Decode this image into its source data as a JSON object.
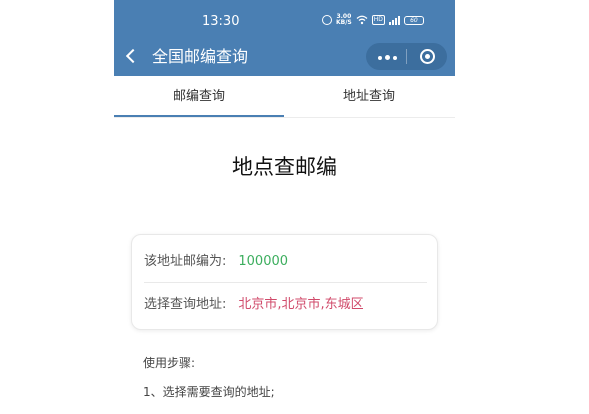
{
  "status_bar": {
    "time": "13:30",
    "speed": "3.00 KB/S",
    "speed_value": "3.00",
    "speed_unit": "KB/S",
    "hd_badge": "HD",
    "battery": "60"
  },
  "header": {
    "title": "全国邮编查询"
  },
  "tabs": [
    {
      "label": "邮编查询",
      "active": true
    },
    {
      "label": "地址查询",
      "active": false
    }
  ],
  "main": {
    "heading": "地点查邮编",
    "postcode_label": "该地址邮编为:",
    "postcode_value": "100000",
    "address_label": "选择查询地址:",
    "address_value": "北京市,北京市,东城区"
  },
  "instructions": {
    "title": "使用步骤:",
    "steps": [
      "1、选择需要查询的地址;"
    ]
  },
  "colors": {
    "brand": "#4a7fb3",
    "postcode": "#3cae5e",
    "address": "#d04a6a"
  }
}
